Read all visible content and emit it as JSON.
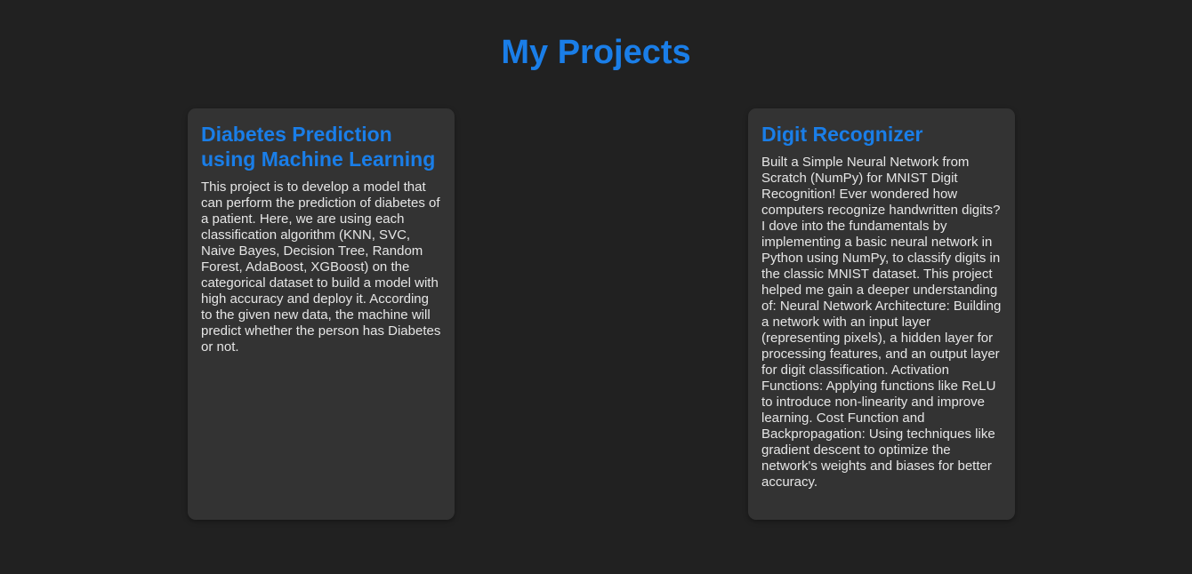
{
  "page": {
    "title": "My Projects"
  },
  "projects": [
    {
      "title": "Diabetes Prediction using Machine Learning",
      "description": "This project is to develop a model that can perform the prediction of diabetes of a patient. Here, we are using each classification algorithm (KNN, SVC, Naive Bayes, Decision Tree, Random Forest, AdaBoost, XGBoost) on the categorical dataset to build a model with high accuracy and deploy it. According to the given new data, the machine will predict whether the person has Diabetes or not."
    },
    {
      "title": "Digit Recognizer",
      "description": "Built a Simple Neural Network from Scratch (NumPy) for MNIST Digit Recognition! Ever wondered how computers recognize handwritten digits? I dove into the fundamentals by implementing a basic neural network in Python using NumPy, to classify digits in the classic MNIST dataset. This project helped me gain a deeper understanding of: Neural Network Architecture: Building a network with an input layer (representing pixels), a hidden layer for processing features, and an output layer for digit classification. Activation Functions: Applying functions like ReLU to introduce non-linearity and improve learning. Cost Function and Backpropagation: Using techniques like gradient descent to optimize the network's weights and biases for better accuracy."
    }
  ],
  "colors": {
    "background": "#212121",
    "card": "#333333",
    "accent": "#1a7ee8",
    "text": "#e6e6e6"
  }
}
